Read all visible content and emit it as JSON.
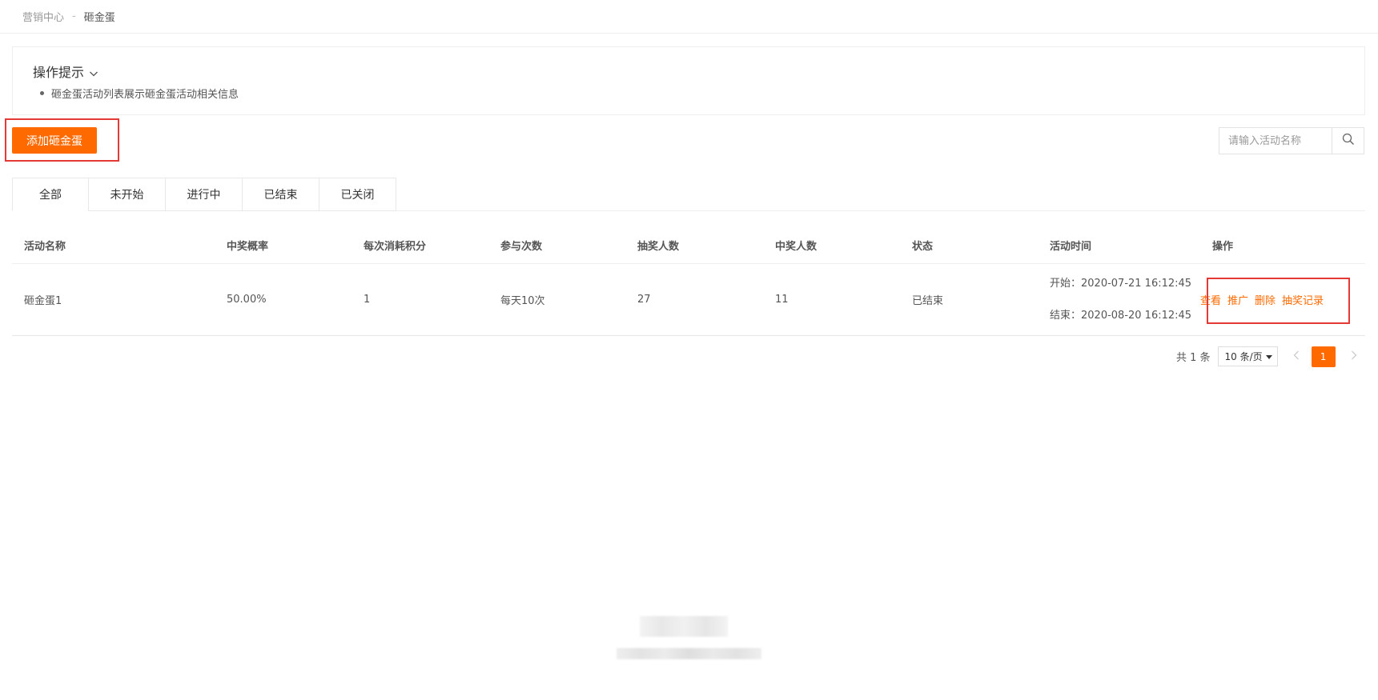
{
  "breadcrumb": {
    "parent": "营销中心",
    "separator": "-",
    "current": "砸金蛋"
  },
  "tips": {
    "title": "操作提示",
    "items": [
      "砸金蛋活动列表展示砸金蛋活动相关信息"
    ]
  },
  "toolbar": {
    "add_label": "添加砸金蛋"
  },
  "search": {
    "placeholder": "请输入活动名称",
    "value": ""
  },
  "tabs": [
    {
      "label": "全部",
      "active": true
    },
    {
      "label": "未开始",
      "active": false
    },
    {
      "label": "进行中",
      "active": false
    },
    {
      "label": "已结束",
      "active": false
    },
    {
      "label": "已关闭",
      "active": false
    }
  ],
  "table": {
    "headers": [
      "活动名称",
      "中奖概率",
      "每次消耗积分",
      "参与次数",
      "抽奖人数",
      "中奖人数",
      "状态",
      "活动时间",
      "操作"
    ],
    "rows": [
      {
        "name": "砸金蛋1",
        "probability": "50.00%",
        "points": "1",
        "times": "每天10次",
        "draw_count": "27",
        "win_count": "11",
        "status": "已结束",
        "start": "开始：2020-07-21 16:12:45",
        "end": "结束：2020-08-20 16:12:45",
        "actions": [
          "查看",
          "推广",
          "删除",
          "抽奖记录"
        ]
      }
    ]
  },
  "pagination": {
    "total": "共 1 条",
    "page_size": "10 条/页",
    "current_page": "1"
  },
  "colors": {
    "accent": "#ff6a00",
    "highlight": "#e53935"
  }
}
